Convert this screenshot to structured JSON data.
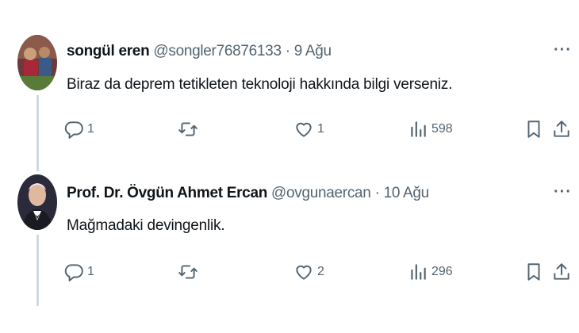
{
  "tweets": [
    {
      "name": "songül eren",
      "handle": "@songler76876133",
      "separator": "·",
      "date": "9 Ağu",
      "text": "Biraz da deprem tetikleten teknoloji hakkında bilgi verseniz.",
      "replies": "1",
      "retweets": "",
      "likes": "1",
      "views": "598"
    },
    {
      "name": "Prof. Dr. Övgün Ahmet Ercan",
      "handle": "@ovgunaercan",
      "separator": "·",
      "date": "10 Ağu",
      "text": "Mağmadaki devingenlik.",
      "replies": "1",
      "retweets": "",
      "likes": "2",
      "views": "296"
    }
  ],
  "more_label": "···",
  "colors": {
    "text": "#0f1419",
    "secondary": "#536471",
    "thread_line": "#cfd9de"
  }
}
